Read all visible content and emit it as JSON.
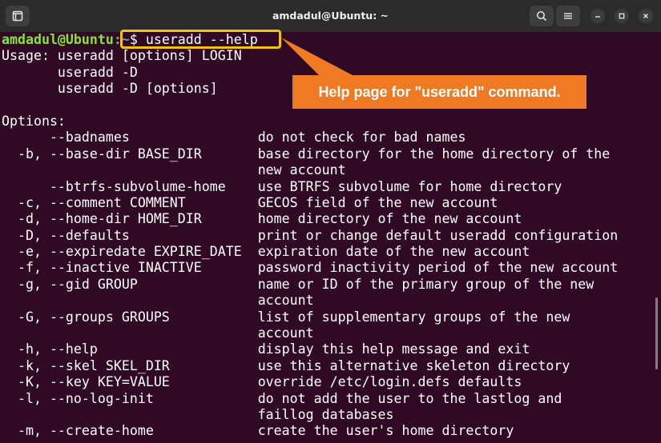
{
  "window": {
    "title": "amdadul@Ubuntu: ~"
  },
  "annotation": {
    "callout_text": "Help page for \"useradd\" command.",
    "accent_color": "#f07a24",
    "highlight_color": "#f4c20d"
  },
  "terminal": {
    "prompt_user": "amdadul@Ubuntu",
    "prompt_path": ":~",
    "prompt_symbol": "$ ",
    "command": "useradd --help",
    "output": [
      "Usage: useradd [options] LOGIN",
      "       useradd -D",
      "       useradd -D [options]",
      "",
      "Options:",
      "      --badnames                do not check for bad names",
      "  -b, --base-dir BASE_DIR       base directory for the home directory of the",
      "                                new account",
      "      --btrfs-subvolume-home    use BTRFS subvolume for home directory",
      "  -c, --comment COMMENT         GECOS field of the new account",
      "  -d, --home-dir HOME_DIR       home directory of the new account",
      "  -D, --defaults                print or change default useradd configuration",
      "  -e, --expiredate EXPIRE_DATE  expiration date of the new account",
      "  -f, --inactive INACTIVE       password inactivity period of the new account",
      "  -g, --gid GROUP               name or ID of the primary group of the new",
      "                                account",
      "  -G, --groups GROUPS           list of supplementary groups of the new",
      "                                account",
      "  -h, --help                    display this help message and exit",
      "  -k, --skel SKEL_DIR           use this alternative skeleton directory",
      "  -K, --key KEY=VALUE           override /etc/login.defs defaults",
      "  -l, --no-log-init             do not add the user to the lastlog and",
      "                                faillog databases",
      "  -m, --create-home             create the user's home directory"
    ]
  },
  "icons": {
    "new_tab": "new-tab-icon",
    "search": "search-icon",
    "menu": "hamburger-menu-icon",
    "minimize": "minimize-icon",
    "maximize": "maximize-icon",
    "close": "close-icon"
  }
}
